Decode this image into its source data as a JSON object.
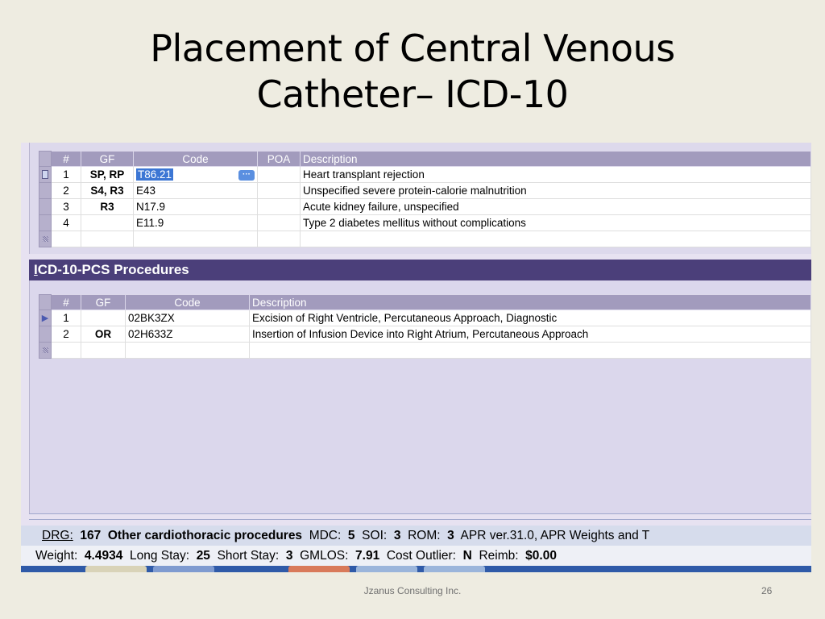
{
  "slide": {
    "title_line1": "Placement of Central Venous",
    "title_line2": "Catheter– ICD-10",
    "footer": "Jzanus Consulting Inc.",
    "page_number": "26"
  },
  "diagnoses": {
    "headers": {
      "num": "#",
      "gf": "GF",
      "code": "Code",
      "poa": "POA",
      "description": "Description"
    },
    "rows": [
      {
        "num": "1",
        "gf": "SP, RP",
        "code": "T86.21",
        "poa": "",
        "description": "Heart transplant rejection"
      },
      {
        "num": "2",
        "gf": "S4, R3",
        "code": "E43",
        "poa": "",
        "description": "Unspecified severe protein-calorie malnutrition"
      },
      {
        "num": "3",
        "gf": "R3",
        "code": "N17.9",
        "poa": "",
        "description": "Acute kidney failure, unspecified"
      },
      {
        "num": "4",
        "gf": "",
        "code": "E11.9",
        "poa": "",
        "description": "Type 2 diabetes mellitus without complications"
      }
    ],
    "ellipsis_label": "···"
  },
  "procedures": {
    "section_title_first": "I",
    "section_title_rest": "CD-10-PCS Procedures",
    "headers": {
      "num": "#",
      "gf": "GF",
      "code": "Code",
      "description": "Description"
    },
    "rows": [
      {
        "num": "1",
        "gf": "",
        "code": "02BK3ZX",
        "description": "Excision of Right Ventricle, Percutaneous Approach, Diagnostic"
      },
      {
        "num": "2",
        "gf": "OR",
        "code": "02H633Z",
        "description": "Insertion of Infusion Device into Right Atrium, Percutaneous Approach"
      }
    ]
  },
  "status_drg": {
    "drg_label": "DRG:",
    "drg_value": "167",
    "drg_desc": "Other cardiothoracic procedures",
    "mdc_label": "MDC:",
    "mdc_value": "5",
    "soi_label": "SOI:",
    "soi_value": "3",
    "rom_label": "ROM:",
    "rom_value": "3",
    "apr_text": "APR ver.31.0, APR Weights and T"
  },
  "status_weight": {
    "weight_label": "Weight:",
    "weight_value": "4.4934",
    "long_stay_label": "Long Stay:",
    "long_stay_value": "25",
    "short_stay_label": "Short Stay:",
    "short_stay_value": "3",
    "gmlos_label": "GMLOS:",
    "gmlos_value": "7.91",
    "cost_outlier_label": "Cost Outlier:",
    "cost_outlier_value": "N",
    "reimb_label": "Reimb:",
    "reimb_value": "$0.00"
  }
}
